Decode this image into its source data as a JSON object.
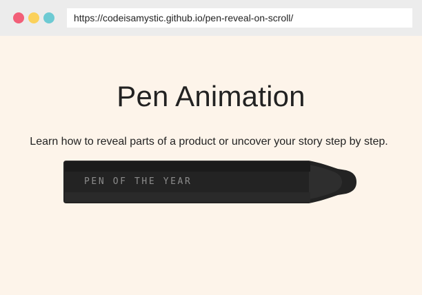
{
  "browser": {
    "url": "https://codeisamystic.github.io/pen-reveal-on-scroll/",
    "window_controls": [
      {
        "name": "close",
        "color": "#f25f78"
      },
      {
        "name": "minimize",
        "color": "#fbd15b"
      },
      {
        "name": "maximize",
        "color": "#6dcad3"
      }
    ]
  },
  "page": {
    "title": "Pen Animation",
    "subtitle": "Learn how to reveal parts of a product or uncover your story step by step.",
    "pen_label": "PEN OF THE YEAR",
    "background_color": "#fdf4ea"
  }
}
